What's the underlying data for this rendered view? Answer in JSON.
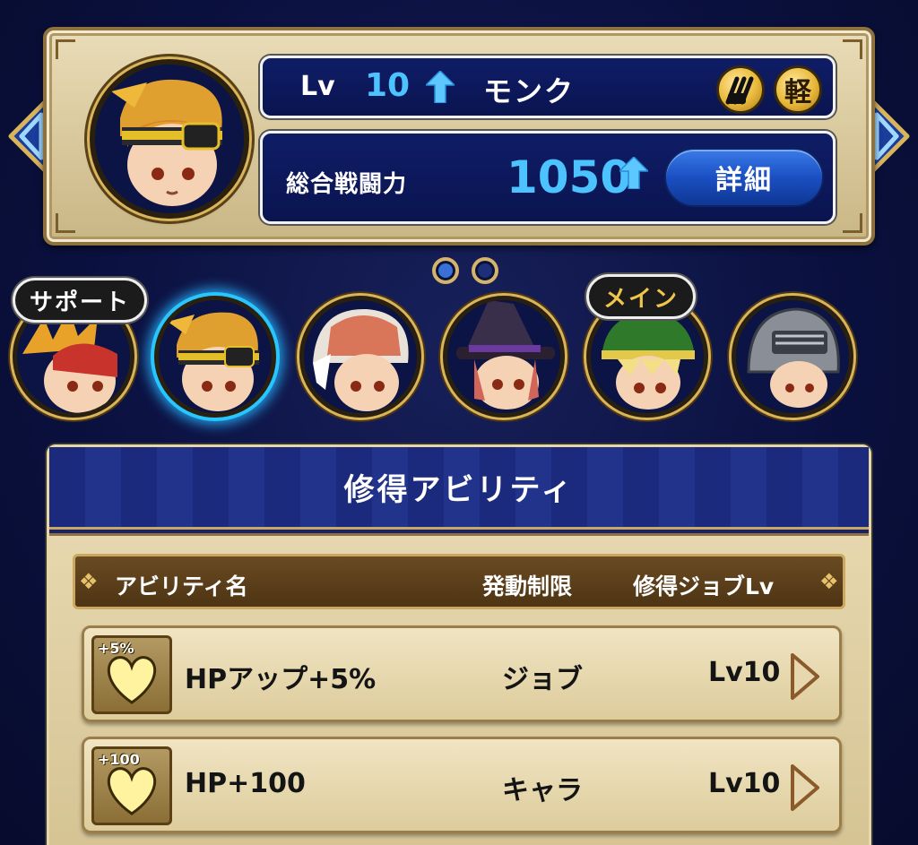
{
  "character": {
    "level_label": "Lv",
    "level": "10",
    "job": "モンク",
    "badge_weight": "軽",
    "badge_weapon_icon": "claw-icon",
    "power_label": "総合戦闘力",
    "power": "1050",
    "detail_button": "詳細"
  },
  "party": {
    "support_tag": "サポート",
    "main_tag": "メイン",
    "members": [
      {
        "role": "support",
        "hair": "#e8a22a",
        "hat": "#c8342c"
      },
      {
        "role": "current",
        "hair": "#d8862a",
        "hat": "#e0a030"
      },
      {
        "role": "member",
        "hair": "#c4734a",
        "hat": "#e9e2d8"
      },
      {
        "role": "member",
        "hair": "#d2655a",
        "hat": "#3a2f4a"
      },
      {
        "role": "main",
        "hair": "#f2df86",
        "hat": "#2e7a2a"
      },
      {
        "role": "member",
        "hair": "#d48c6a",
        "hat": "#8a8e96"
      }
    ]
  },
  "pages": {
    "count": 2,
    "active": 0
  },
  "abilities": {
    "title": "修得アビリティ",
    "columns": {
      "name": "アビリティ名",
      "limit": "発動制限",
      "level": "修得ジョブLv"
    },
    "rows": [
      {
        "icon_tag": "+5%",
        "icon": "heart-icon",
        "name": "HPアップ+5%",
        "limit": "ジョブ",
        "level": "Lv10"
      },
      {
        "icon_tag": "+100",
        "icon": "heart-icon",
        "name": "HP+100",
        "limit": "キャラ",
        "level": "Lv10"
      }
    ]
  },
  "colors": {
    "accent_blue": "#4cc2ff",
    "gold": "#d9b45a",
    "panel": "#e6d7ae"
  }
}
